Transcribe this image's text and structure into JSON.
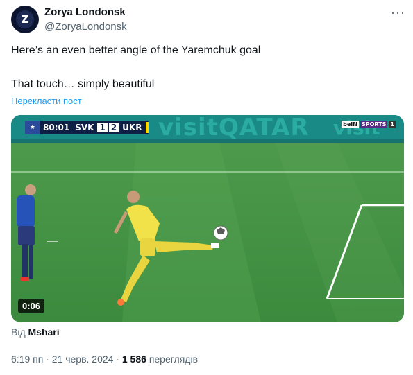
{
  "author": {
    "name": "Zorya Londonsk",
    "handle": "@ZoryaLondonsk",
    "avatar_letter": "Z"
  },
  "tweet": {
    "line1": "Here’s an even better angle of the Yaremchuk goal",
    "line2": "That touch… simply beautiful",
    "translate_label": "Перекласти пост"
  },
  "video": {
    "scoreboard": {
      "time": "80:01",
      "team_home": "SVK",
      "score_home": "1",
      "score_away": "2",
      "team_away": "UKR"
    },
    "banner_text": "visitQATAR",
    "banner_text_right": "visit",
    "broadcaster": [
      "beIN",
      "SPORTS",
      "1"
    ],
    "duration": "0:06"
  },
  "source": {
    "prefix": "Від",
    "name": "Mshari"
  },
  "meta": {
    "time_date": "6:19 пп · 21 черв. 2024 ·",
    "views_count": "1 586",
    "views_label": "переглядів"
  },
  "icons": {
    "more": "more-horizontal-icon",
    "play": "video-player"
  },
  "colors": {
    "link": "#1d9bf0",
    "secondary_text": "#536471",
    "pitch_green": "#3d8a40",
    "banner_teal": "#1a8a86"
  }
}
